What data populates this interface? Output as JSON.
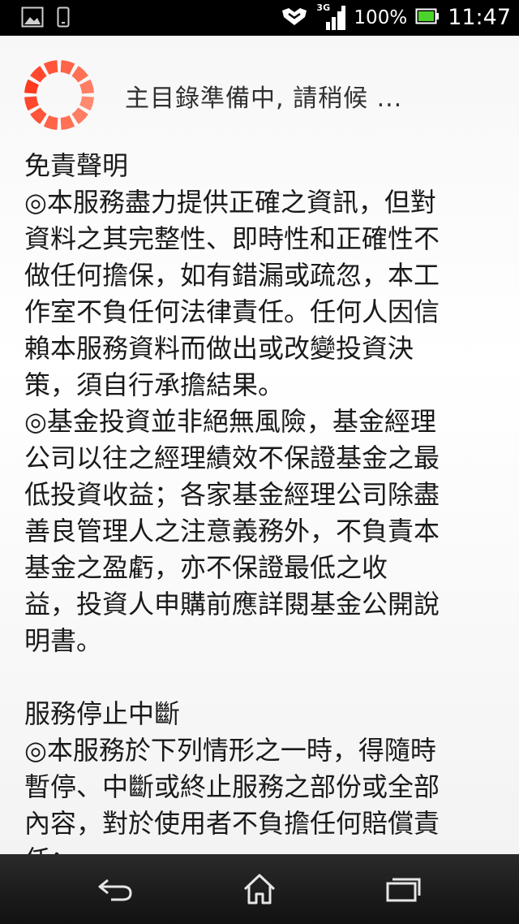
{
  "status_bar": {
    "network_type": "3G",
    "battery_percent": "100%",
    "time": "11:47",
    "icons": [
      "picture-icon",
      "phone-icon",
      "signal-handshake-icon",
      "cell-signal-icon",
      "battery-icon"
    ]
  },
  "loading": {
    "text": "主目錄準備中, 請稍候 ...",
    "spinner_colors": [
      "#ff3b1f",
      "#ff8a70"
    ]
  },
  "disclaimer_lines": [
    "免責聲明",
    "◎本服務盡力提供正確之資訊，但對",
    "資料之其完整性、即時性和正確性不",
    "做任何擔保，如有錯漏或疏忽，本工",
    "作室不負任何法律責任。任何人因信",
    "賴本服務資料而做出或改變投資決",
    "策，須自行承擔結果。",
    "◎基金投資並非絕無風險，基金經理",
    "公司以往之經理績效不保證基金之最",
    "低投資收益；各家基金經理公司除盡",
    "善良管理人之注意義務外，不負責本",
    "基金之盈虧，亦不保證最低之收",
    "益，投資人申購前應詳閱基金公開說",
    "明書。",
    "",
    "服務停止中斷",
    "◎本服務於下列情形之一時，得隨時",
    "暫停、中斷或終止服務之部份或全部",
    "內容，對於使用者不負擔任何賠償責",
    "任："
  ],
  "nav_bar": {
    "icons": [
      "back-icon",
      "home-icon",
      "recent-apps-icon"
    ]
  }
}
